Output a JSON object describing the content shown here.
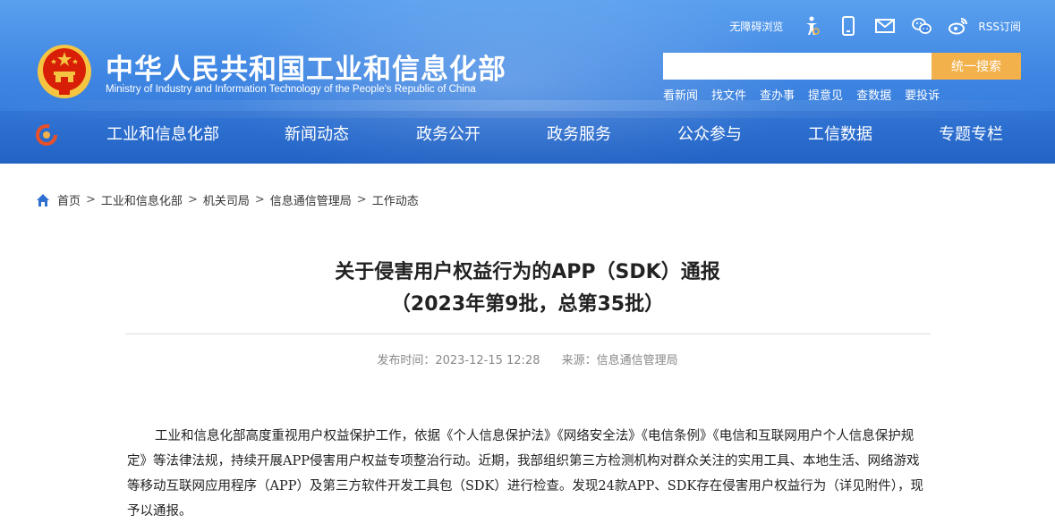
{
  "header": {
    "site_title": "中华人民共和国工业和信息化部",
    "site_subtitle": "Ministry of Industry and Information Technology of the People's Republic of China",
    "accessibility_label": "无障碍浏览",
    "rss_label": "RSS订阅",
    "search": {
      "placeholder": "",
      "button_label": "统一搜索"
    },
    "quick_links": [
      "看新闻",
      "找文件",
      "查办事",
      "提意见",
      "查数据",
      "要投诉"
    ]
  },
  "nav": {
    "items": [
      "工业和信息化部",
      "新闻动态",
      "政务公开",
      "政务服务",
      "公众参与",
      "工信数据",
      "专题专栏"
    ]
  },
  "breadcrumb": {
    "items": [
      "首页",
      "工业和信息化部",
      "机关司局",
      "信息通信管理局",
      "工作动态"
    ],
    "separator": ">"
  },
  "article": {
    "title_line1": "关于侵害用户权益行为的APP（SDK）通报",
    "title_line2": "（2023年第9批，总第35批）",
    "publish_time": "发布时间：2023-12-15 12:28",
    "source": "来源：信息通信管理局",
    "paragraph": "工业和信息化部高度重视用户权益保护工作，依据《个人信息保护法》《网络安全法》《电信条例》《电信和互联网用户个人信息保护规定》等法律法规，持续开展APP侵害用户权益专项整治行动。近期，我部组织第三方检测机构对群众关注的实用工具、本地生活、网络游戏等移动互联网应用程序（APP）及第三方软件开发工具包（SDK）进行检查。发现24款APP、SDK存在侵害用户权益行为（详见附件），现予以通报。"
  },
  "colors": {
    "header_blue": "#3f86e3",
    "search_button": "#f3b14b",
    "emblem_red": "#d81e06",
    "emblem_gold": "#f5c542",
    "breadcrumb_icon": "#2f6fd0"
  },
  "icons": [
    "national-emblem",
    "accessibility-icon",
    "mobile-icon",
    "mail-icon",
    "wechat-icon",
    "weibo-icon",
    "rss-icon",
    "nav-logo-icon",
    "home-icon"
  ]
}
